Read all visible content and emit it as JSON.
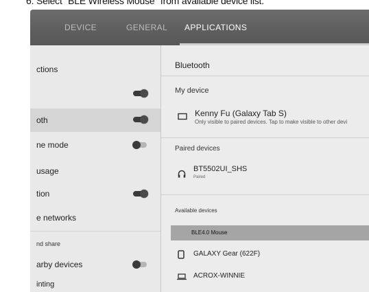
{
  "instruction": "6. Select \"BLE Wireless Mouse\" from available device list.",
  "tabs": {
    "device": "DEVICE",
    "general": "GENERAL",
    "applications": "APPLICATIONS"
  },
  "left_menu": {
    "section_connections": "ctions",
    "items": [
      {
        "label": "oth",
        "toggle": "on",
        "selected": true
      },
      {
        "label": "ne mode",
        "toggle": "off"
      },
      {
        "label": "usage"
      },
      {
        "label": "tion",
        "toggle": "on"
      },
      {
        "label": "e networks"
      },
      {
        "label": "nd share"
      },
      {
        "label": "arby devices",
        "toggle": "off"
      },
      {
        "label": "inting"
      }
    ],
    "first_toggle": "on"
  },
  "bluetooth": {
    "title": "Bluetooth",
    "my_device_header": "My device",
    "my_device_name": "Kenny Fu (Galaxy Tab S)",
    "my_device_sub": "Only visible to paired devices. Tap to make visible to other devi",
    "paired_header": "Paired devices",
    "paired": [
      {
        "name": "BT5502UI_SHS",
        "status": "Paired",
        "icon": "headphones-icon"
      }
    ],
    "available_header": "Available devices",
    "available": [
      {
        "name": "BLE4.0 Mouse",
        "icon": "",
        "highlighted": true
      },
      {
        "name": "GALAXY Gear (622F)",
        "icon": "watch-icon"
      },
      {
        "name": "ACROX-WINNIE",
        "icon": "laptop-icon"
      }
    ]
  }
}
